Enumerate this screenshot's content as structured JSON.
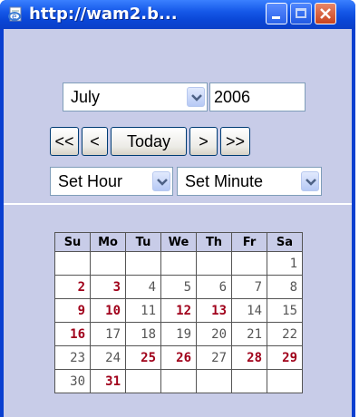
{
  "window": {
    "title": "http://wam2.b..."
  },
  "controls": {
    "month_selected": "July",
    "year_value": "2006",
    "nav_first": "<<",
    "nav_prev": "<",
    "nav_today": "Today",
    "nav_next": ">",
    "nav_last": ">>",
    "hour_selected": "Set Hour",
    "minute_selected": "Set Minute"
  },
  "calendar": {
    "day_headers": [
      "Su",
      "Mo",
      "Tu",
      "We",
      "Th",
      "Fr",
      "Sa"
    ],
    "weeks": [
      [
        "",
        "",
        "",
        "",
        "",
        "",
        "1"
      ],
      [
        "2",
        "3",
        "4",
        "5",
        "6",
        "7",
        "8"
      ],
      [
        "9",
        "10",
        "11",
        "12",
        "13",
        "14",
        "15"
      ],
      [
        "16",
        "17",
        "18",
        "19",
        "20",
        "21",
        "22"
      ],
      [
        "23",
        "24",
        "25",
        "26",
        "27",
        "28",
        "29"
      ],
      [
        "30",
        "31",
        "",
        "",
        "",
        "",
        ""
      ]
    ],
    "highlight_color": "#a0001a"
  }
}
